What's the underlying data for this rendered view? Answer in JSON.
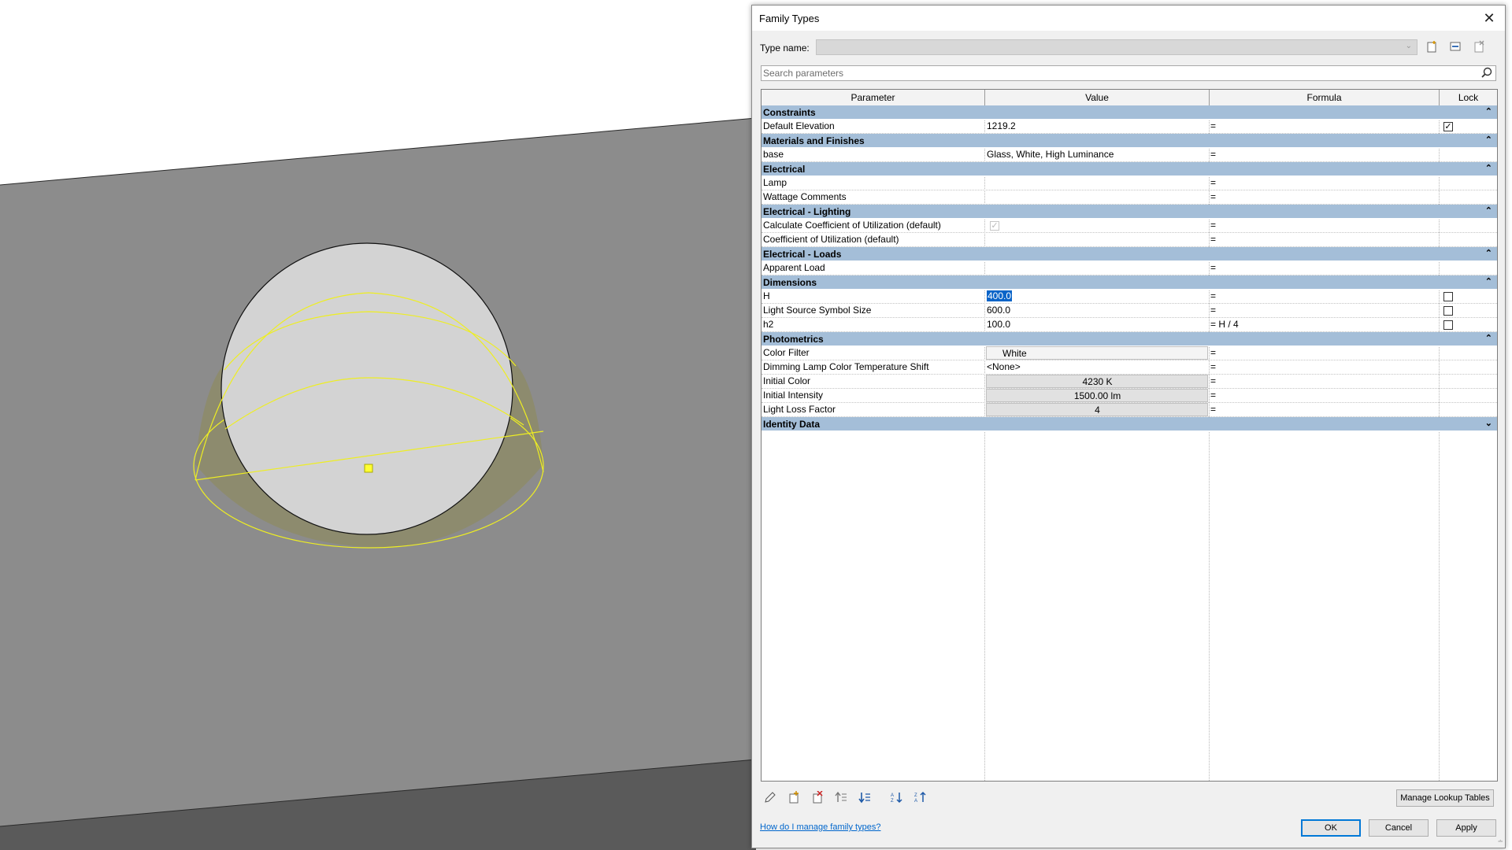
{
  "dialog": {
    "title": "Family Types",
    "close_symbol": "✕",
    "type_name_label": "Type name:",
    "type_name_value": "",
    "search_placeholder": "Search parameters",
    "columns": [
      "Parameter",
      "Value",
      "Formula",
      "Lock"
    ],
    "groups": [
      {
        "label": "Constraints",
        "toggle": "⌃",
        "rows": [
          {
            "param": "Default Elevation",
            "value": "1219.2",
            "formula": "=",
            "lock": "checked"
          }
        ]
      },
      {
        "label": "Materials and Finishes",
        "toggle": "⌃",
        "rows": [
          {
            "param": "base",
            "value": "Glass, White, High Luminance",
            "formula": "=",
            "lock": "none"
          }
        ]
      },
      {
        "label": "Electrical",
        "toggle": "⌃",
        "rows": [
          {
            "param": "Lamp",
            "value": "",
            "formula": "=",
            "lock": "none"
          },
          {
            "param": "Wattage Comments",
            "value": "",
            "formula": "=",
            "lock": "none"
          }
        ]
      },
      {
        "label": "Electrical - Lighting",
        "toggle": "⌃",
        "rows": [
          {
            "param": "Calculate Coefficient of Utilization (default)",
            "value": "",
            "value_style": "disabled-check",
            "formula": "=",
            "lock": "none"
          },
          {
            "param": "Coefficient of Utilization (default)",
            "value": "",
            "formula": "=",
            "lock": "none"
          }
        ]
      },
      {
        "label": "Electrical - Loads",
        "toggle": "⌃",
        "rows": [
          {
            "param": "Apparent Load",
            "value": "",
            "formula": "=",
            "lock": "none"
          }
        ]
      },
      {
        "label": "Dimensions",
        "toggle": "⌃",
        "rows": [
          {
            "param": "H",
            "value": "400.0",
            "value_style": "selected",
            "formula": "=",
            "lock": "unchecked"
          },
          {
            "param": "Light Source Symbol Size",
            "value": "600.0",
            "formula": "=",
            "lock": "unchecked"
          },
          {
            "param": "h2",
            "value": "100.0",
            "formula": "= H / 4",
            "lock": "unchecked"
          }
        ]
      },
      {
        "label": "Photometrics",
        "toggle": "⌃",
        "rows": [
          {
            "param": "Color Filter",
            "value": "White",
            "value_style": "white-box",
            "formula": "=",
            "lock": "none"
          },
          {
            "param": "Dimming Lamp Color Temperature Shift",
            "value": "<None>",
            "formula": "=",
            "lock": "none"
          },
          {
            "param": "Initial Color",
            "value": "4230 K",
            "value_style": "box",
            "formula": "=",
            "lock": "none"
          },
          {
            "param": "Initial Intensity",
            "value": "1500.00 lm",
            "value_style": "box",
            "formula": "=",
            "lock": "none"
          },
          {
            "param": "Light Loss Factor",
            "value": "4",
            "value_style": "box",
            "formula": "=",
            "lock": "none"
          }
        ]
      },
      {
        "label": "Identity Data",
        "toggle": "⌄",
        "rows": []
      }
    ],
    "manage_lookup_label": "Manage Lookup Tables",
    "help_link": "How do I manage family types?",
    "ok_label": "OK",
    "cancel_label": "Cancel",
    "apply_label": "Apply"
  },
  "icons": {
    "new_type": "new-type-icon",
    "rename_type": "rename-type-icon",
    "delete_type": "delete-type-icon",
    "search": "search-icon",
    "edit_parameter": "pencil-icon",
    "new_parameter": "new-parameter-icon",
    "delete_parameter": "delete-parameter-icon",
    "move_up": "move-up-icon",
    "move_down": "move-down-icon",
    "sort_ascending": "sort-ascending-icon",
    "sort_descending": "sort-descending-icon"
  },
  "colors": {
    "group_header": "#a4bed8",
    "selection": "#0a64c8",
    "viewport_wall": "#8c8c8c",
    "light_outline": "#f0f000"
  }
}
